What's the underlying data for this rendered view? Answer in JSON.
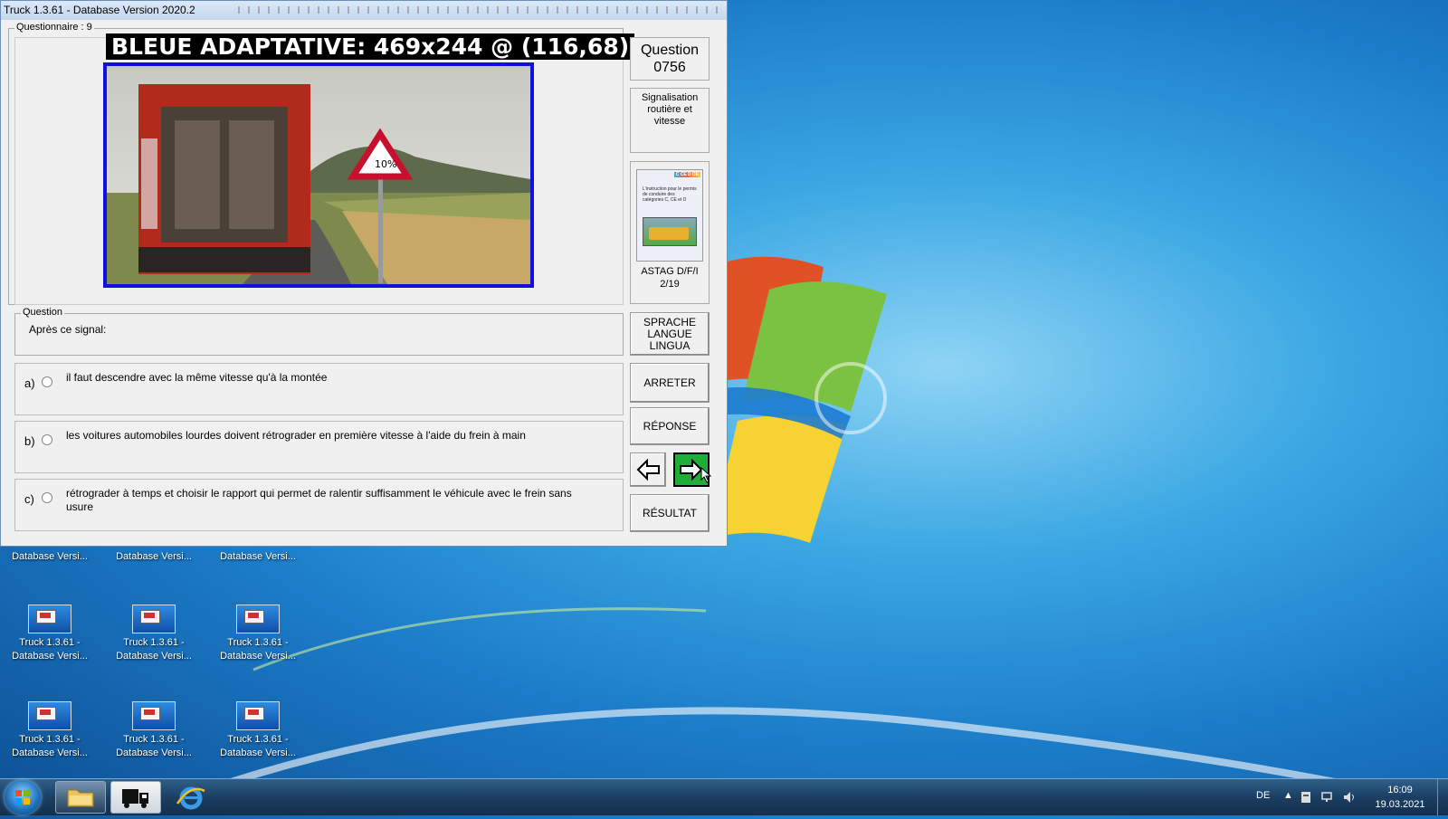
{
  "window": {
    "title": "Truck 1.3.61 - Database Version 2020.2",
    "questionnaire_label": "Questionnaire : 9",
    "overlay_label": "BLEUE ADAPTATIVE: 469x244 @ (116,68)"
  },
  "sidebar": {
    "question_heading": "Question",
    "question_number": "0756",
    "category_line1": "Signalisation",
    "category_line2": "routière et vitesse",
    "book_title_line1": "ASTAG D/F/I",
    "book_title_line2": "2/19",
    "book_cover_tag": "C CE D DE",
    "book_cover_text": "L'instruction pour le permis de conduire des catégories C, CE et D",
    "language_button": [
      "SPRACHE",
      "LANGUE",
      "LINGUA"
    ],
    "stop_button": "ARRETER",
    "answer_button": "RÉPONSE",
    "result_button": "RÉSULTAT"
  },
  "question": {
    "group_label": "Question",
    "text": "Après ce signal:",
    "sign_text": "10%",
    "answers": [
      {
        "letter": "a)",
        "text": "il faut descendre avec la même vitesse qu'à la montée"
      },
      {
        "letter": "b)",
        "text": "les voitures automobiles lourdes doivent rétrograder en première vitesse à l'aide du frein à main"
      },
      {
        "letter": "c)",
        "text": "rétrograder à temps et choisir le rapport qui permet de ralentir suffisamment le véhicule avec le frein sans usure"
      }
    ]
  },
  "desktop": {
    "icons": [
      {
        "label1": "Database Versi...",
        "label2": ""
      },
      {
        "label1": "Database Versi...",
        "label2": ""
      },
      {
        "label1": "Database Versi...",
        "label2": ""
      },
      {
        "label1": "Truck 1.3.61 -",
        "label2": "Database Versi..."
      },
      {
        "label1": "Truck 1.3.61 -",
        "label2": "Database Versi..."
      },
      {
        "label1": "Truck 1.3.61 -",
        "label2": "Database Versi..."
      },
      {
        "label1": "Truck 1.3.61 -",
        "label2": "Database Versi..."
      },
      {
        "label1": "Truck 1.3.61 -",
        "label2": "Database Versi..."
      },
      {
        "label1": "Truck 1.3.61 -",
        "label2": "Database Versi..."
      }
    ]
  },
  "taskbar": {
    "language": "DE",
    "time": "16:09",
    "date": "19.03.2021"
  }
}
